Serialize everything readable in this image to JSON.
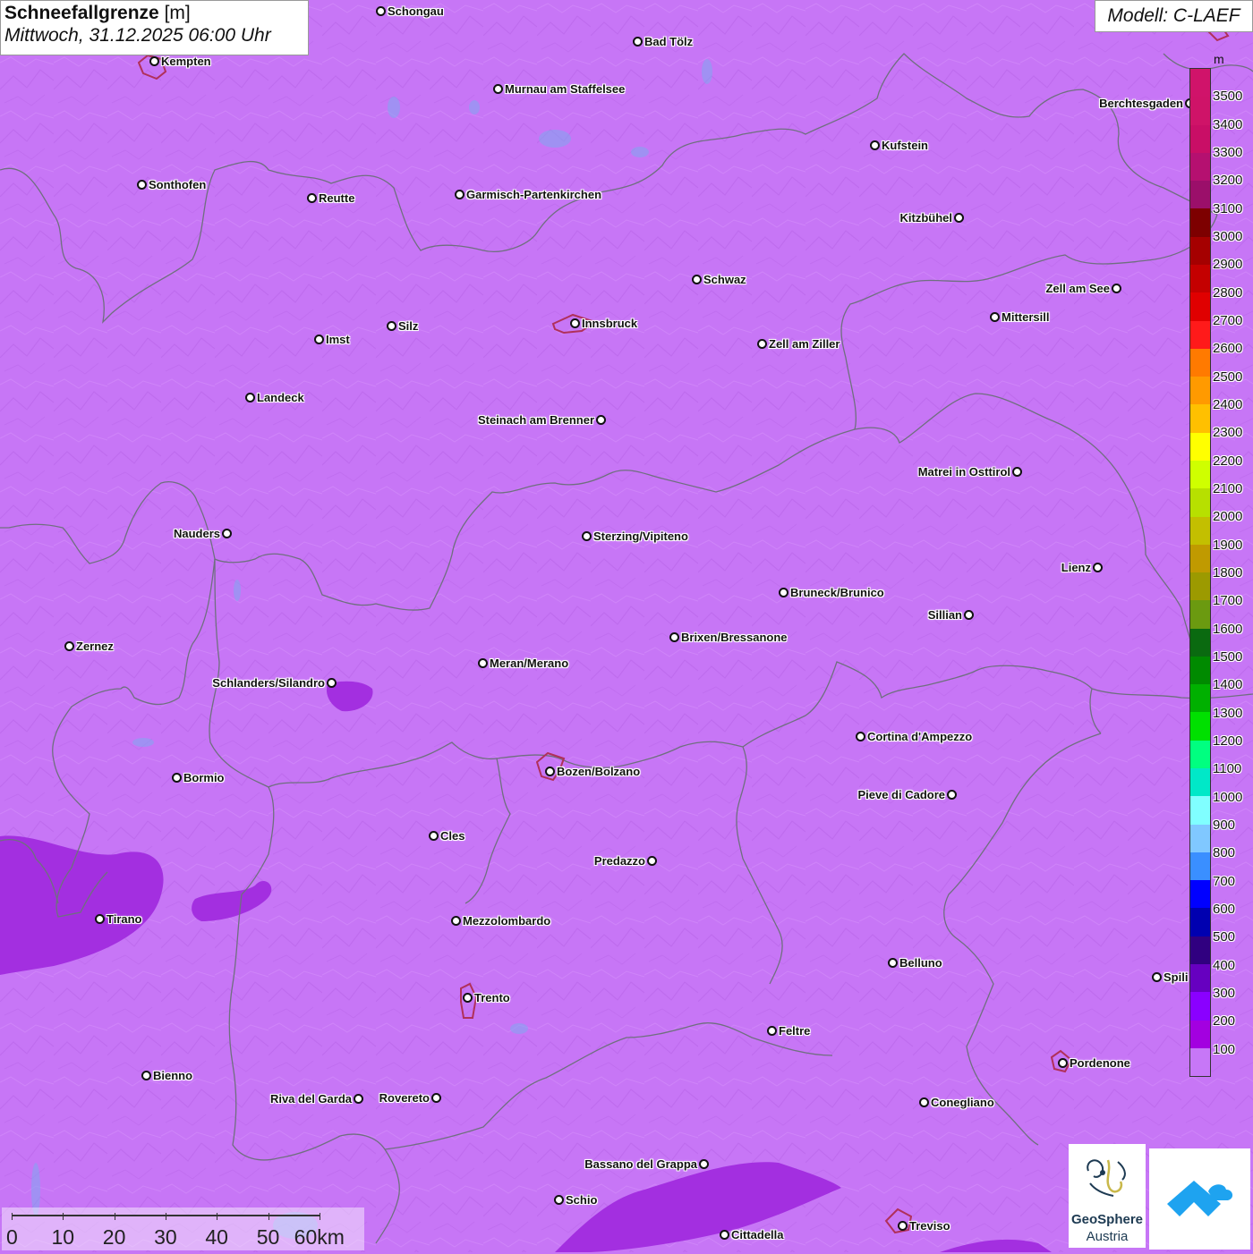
{
  "header": {
    "title_bold": "Schneefallgrenze",
    "title_unit": "[m]",
    "subtitle": "Mittwoch, 31.12.2025 06:00 Uhr",
    "model": "Modell: C-LAEF"
  },
  "colors": {
    "background_field": "#c776f6",
    "lower_snowline_field": "#a32fe0",
    "borders": "#6f6f7f",
    "city_outline": "#b0305a"
  },
  "cities": [
    {
      "name": "Schongau"
    },
    {
      "name": "Bad Tölz"
    },
    {
      "name": "Kempten"
    },
    {
      "name": "Murnau am Staffelsee"
    },
    {
      "name": "Berchtesgaden"
    },
    {
      "name": "Kufstein"
    },
    {
      "name": "Sonthofen"
    },
    {
      "name": "Reutte"
    },
    {
      "name": "Garmisch-Partenkirchen"
    },
    {
      "name": "Kitzbühel"
    },
    {
      "name": "Schwaz"
    },
    {
      "name": "Zell am See"
    },
    {
      "name": "Innsbruck"
    },
    {
      "name": "Mittersill"
    },
    {
      "name": "Silz"
    },
    {
      "name": "Imst"
    },
    {
      "name": "Zell am Ziller"
    },
    {
      "name": "Landeck"
    },
    {
      "name": "Steinach am Brenner"
    },
    {
      "name": "Matrei in Osttirol"
    },
    {
      "name": "Nauders"
    },
    {
      "name": "Sterzing/Vipiteno"
    },
    {
      "name": "Lienz"
    },
    {
      "name": "Bruneck/Brunico"
    },
    {
      "name": "Sillian"
    },
    {
      "name": "Zernez"
    },
    {
      "name": "Brixen/Bressanone"
    },
    {
      "name": "Meran/Merano"
    },
    {
      "name": "Schlanders/Silandro"
    },
    {
      "name": "Cortina d'Ampezzo"
    },
    {
      "name": "Bormio"
    },
    {
      "name": "Bozen/Bolzano"
    },
    {
      "name": "Pieve di Cadore"
    },
    {
      "name": "Cles"
    },
    {
      "name": "Predazzo"
    },
    {
      "name": "Tirano"
    },
    {
      "name": "Mezzolombardo"
    },
    {
      "name": "Belluno"
    },
    {
      "name": "Spili"
    },
    {
      "name": "Trento"
    },
    {
      "name": "Feltre"
    },
    {
      "name": "Pordenone"
    },
    {
      "name": "Bienno"
    },
    {
      "name": "Riva del Garda"
    },
    {
      "name": "Rovereto"
    },
    {
      "name": "Conegliano"
    },
    {
      "name": "Bassano del Grappa"
    },
    {
      "name": "Schio"
    },
    {
      "name": "Treviso"
    },
    {
      "name": "Cittadella"
    }
  ],
  "legend": {
    "unit": "m",
    "labels": [
      "3500",
      "3400",
      "3300",
      "3200",
      "3100",
      "3000",
      "2900",
      "2800",
      "2700",
      "2600",
      "2500",
      "2400",
      "2300",
      "2200",
      "2100",
      "2000",
      "1900",
      "1800",
      "1700",
      "1600",
      "1500",
      "1400",
      "1300",
      "1200",
      "1100",
      "1000",
      "900",
      "800",
      "700",
      "600",
      "500",
      "400",
      "300",
      "200",
      "100"
    ],
    "colors": [
      "#d0136a",
      "#cf1368",
      "#c90e66",
      "#b51070",
      "#9b0f6a",
      "#7d0000",
      "#a50000",
      "#c40000",
      "#e00000",
      "#ff1a1a",
      "#ff7a00",
      "#ff9a00",
      "#ffc000",
      "#ffff00",
      "#cfff00",
      "#b7e000",
      "#c3bf00",
      "#c09a00",
      "#9c9a00",
      "#6b9a10",
      "#0a6a10",
      "#008a00",
      "#00b000",
      "#00e000",
      "#00ff80",
      "#00e8c8",
      "#80ffff",
      "#80c8ff",
      "#3a8fff",
      "#0000ff",
      "#0000b0",
      "#300080",
      "#6600c0",
      "#8a00ff",
      "#a300e0",
      "#c777f7"
    ]
  },
  "scalebar": {
    "labels": [
      "0",
      "10",
      "20",
      "30",
      "40",
      "50",
      "60km"
    ]
  },
  "logos": {
    "geosphere_line1": "GeoSphere",
    "geosphere_line2": "Austria"
  }
}
